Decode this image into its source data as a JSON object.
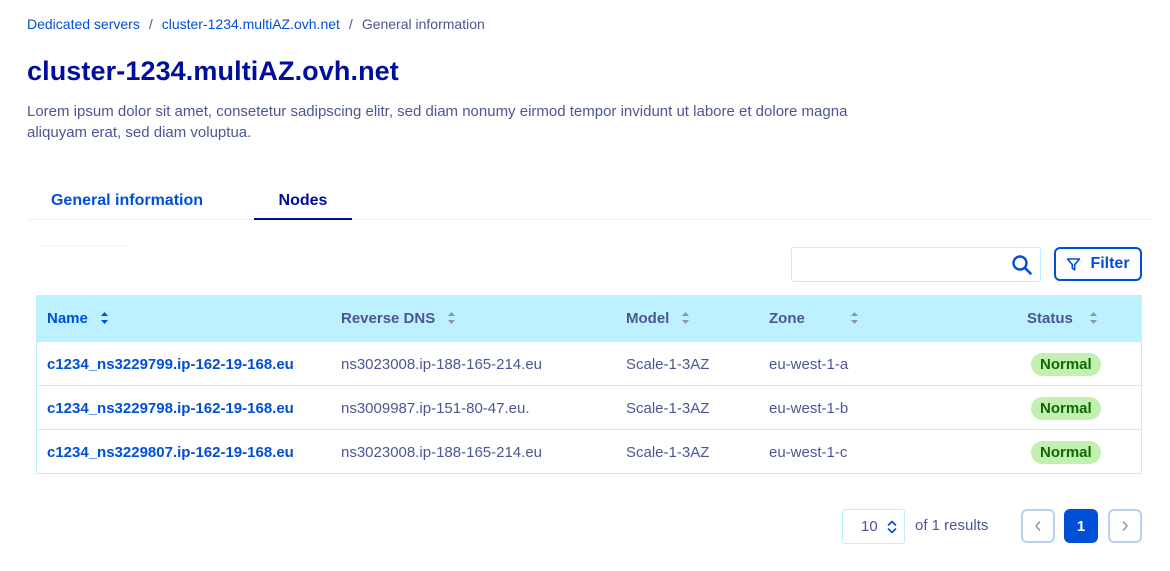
{
  "breadcrumb": {
    "items": [
      "Dedicated servers",
      "cluster-1234.multiAZ.ovh.net"
    ],
    "current": "General information",
    "separator": "/"
  },
  "page": {
    "title": "cluster-1234.multiAZ.ovh.net",
    "description": "Lorem ipsum dolor sit amet, consetetur sadipscing elitr, sed diam nonumy eirmod tempor invidunt ut labore et dolore magna aliquyam erat, sed diam voluptua."
  },
  "tabs": [
    {
      "label": "General information",
      "active": false
    },
    {
      "label": "Nodes",
      "active": true
    }
  ],
  "search": {
    "value": "",
    "placeholder": "",
    "icon": "search-icon"
  },
  "filter": {
    "label": "Filter",
    "icon": "filter-icon"
  },
  "table": {
    "columns": [
      "Name",
      "Reverse DNS",
      "Model",
      "Zone",
      "Status"
    ],
    "rows": [
      {
        "name": "c1234_ns3229799.ip-162-19-168.eu",
        "dns": "ns3023008.ip-188-165-214.eu",
        "model": "Scale-1-3AZ",
        "zone": "eu-west-1-a",
        "status": "Normal"
      },
      {
        "name": "c1234_ns3229798.ip-162-19-168.eu",
        "dns": "ns3009987.ip-151-80-47.eu.",
        "model": "Scale-1-3AZ",
        "zone": "eu-west-1-b",
        "status": "Normal"
      },
      {
        "name": "c1234_ns3229807.ip-162-19-168.eu",
        "dns": "ns3023008.ip-188-165-214.eu",
        "model": "Scale-1-3AZ",
        "zone": "eu-west-1-c",
        "status": "Normal"
      }
    ]
  },
  "pagination": {
    "page_size": "10",
    "results_text": "of 1 results",
    "current_page": "1"
  },
  "colors": {
    "primary": "#0050d7",
    "title": "#000e9c",
    "text": "#4d5693",
    "header_bg": "#bef1ff",
    "status_bg": "#c2f0b0",
    "status_text": "#0e6a00"
  }
}
